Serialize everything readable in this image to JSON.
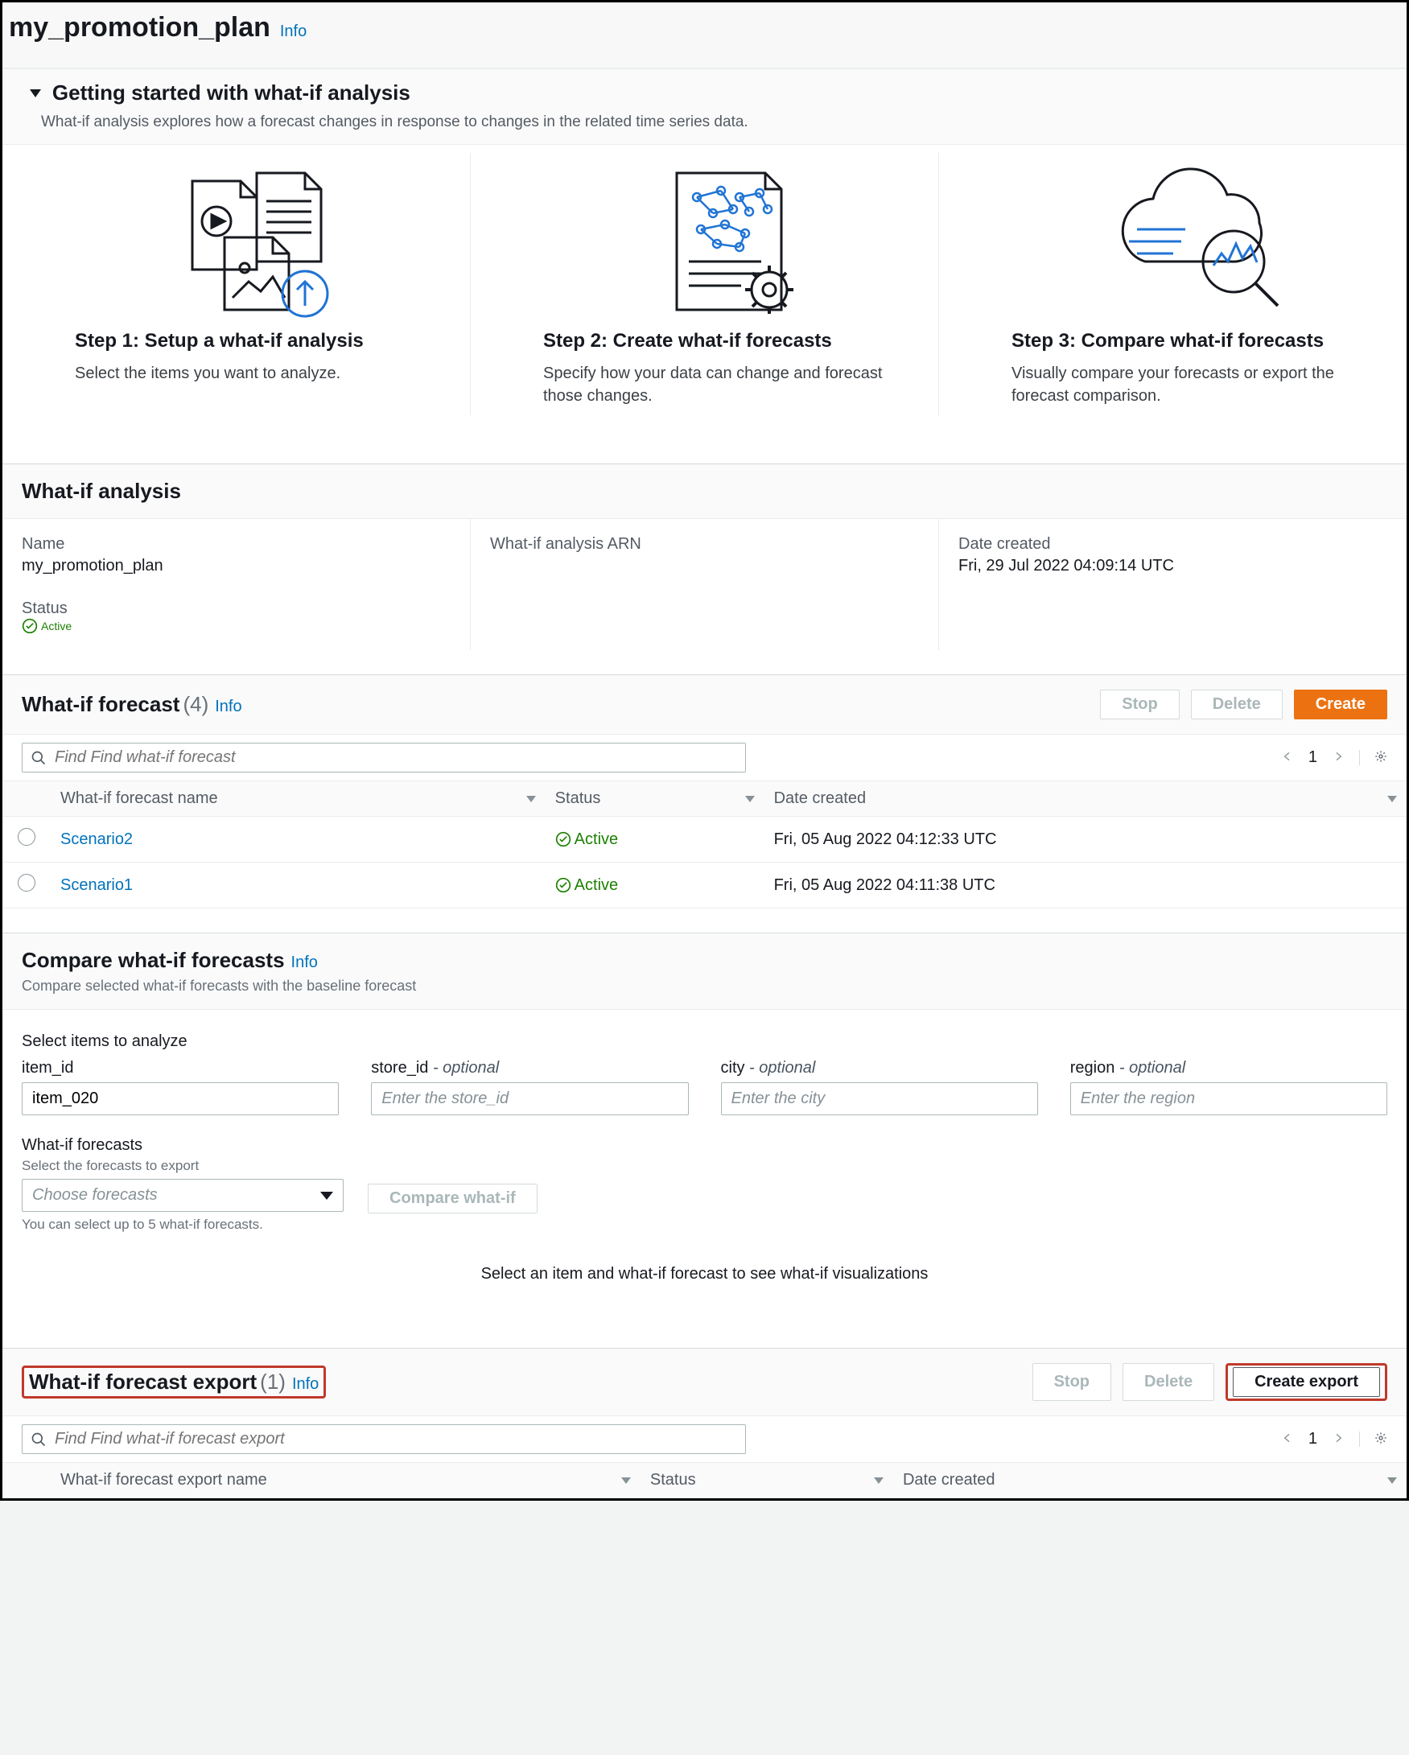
{
  "page": {
    "title": "my_promotion_plan",
    "info": "Info"
  },
  "getting_started": {
    "heading": "Getting started with what-if analysis",
    "subtext": "What-if analysis explores how a forecast changes in response to changes in the related time series data.",
    "steps": [
      {
        "title": "Step 1: Setup a what-if analysis",
        "desc": "Select the items you want to analyze."
      },
      {
        "title": "Step 2: Create what-if forecasts",
        "desc": "Specify how your data can change and forecast those changes."
      },
      {
        "title": "Step 3: Compare what-if forecasts",
        "desc": "Visually compare your forecasts or export the forecast comparison."
      }
    ]
  },
  "analysis_panel": {
    "heading": "What-if analysis",
    "name_lbl": "Name",
    "name_val": "my_promotion_plan",
    "arn_lbl": "What-if analysis ARN",
    "arn_val": "",
    "date_lbl": "Date created",
    "date_val": "Fri, 29 Jul 2022 04:09:14 UTC",
    "status_lbl": "Status",
    "status_val": "Active"
  },
  "forecast_panel": {
    "heading": "What-if forecast",
    "count": "(4)",
    "info": "Info",
    "buttons": {
      "stop": "Stop",
      "delete": "Delete",
      "create": "Create"
    },
    "search_ph": "Find Find what-if forecast",
    "page_num": "1",
    "cols": {
      "name": "What-if forecast name",
      "status": "Status",
      "date": "Date created"
    },
    "rows": [
      {
        "name": "Scenario2",
        "status": "Active",
        "date": "Fri, 05 Aug 2022 04:12:33 UTC"
      },
      {
        "name": "Scenario1",
        "status": "Active",
        "date": "Fri, 05 Aug 2022 04:11:38 UTC"
      }
    ]
  },
  "compare_panel": {
    "heading": "Compare what-if forecasts",
    "info": "Info",
    "sub": "Compare selected what-if forecasts with the baseline forecast",
    "select_lbl": "Select items to analyze",
    "fields": {
      "item": {
        "label": "item_id",
        "optional": "",
        "value": "item_020",
        "ph": ""
      },
      "store": {
        "label": "store_id",
        "optional": " - optional",
        "value": "",
        "ph": "Enter the store_id"
      },
      "city": {
        "label": "city",
        "optional": " - optional",
        "value": "",
        "ph": "Enter the city"
      },
      "region": {
        "label": "region",
        "optional": " - optional",
        "value": "",
        "ph": "Enter the region"
      }
    },
    "wf_heading": "What-if forecasts",
    "wf_sub": "Select the forecasts to export",
    "wf_dd_ph": "Choose forecasts",
    "wf_hint": "You can select up to 5 what-if forecasts.",
    "compare_btn": "Compare what-if",
    "center_msg": "Select an item and what-if forecast to see what-if visualizations"
  },
  "export_panel": {
    "heading": "What-if forecast export",
    "count": "(1)",
    "info": "Info",
    "buttons": {
      "stop": "Stop",
      "delete": "Delete",
      "create": "Create export"
    },
    "search_ph": "Find Find what-if forecast export",
    "page_num": "1",
    "cols": {
      "name": "What-if forecast export name",
      "status": "Status",
      "date": "Date created"
    }
  }
}
